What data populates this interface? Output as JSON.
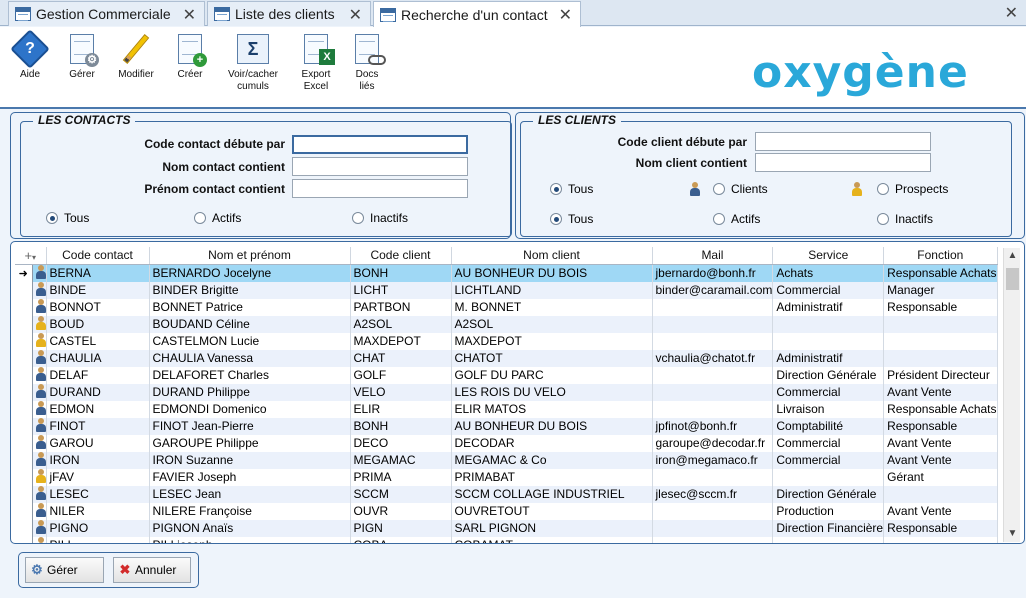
{
  "tabs": [
    {
      "label": "Gestion Commerciale",
      "active": false
    },
    {
      "label": "Liste des clients",
      "active": false
    },
    {
      "label": "Recherche d'un contact",
      "active": true
    }
  ],
  "toolbar": {
    "aide": "Aide",
    "gerer": "Gérer",
    "modifier": "Modifier",
    "creer": "Créer",
    "voir_line1": "Voir/cacher",
    "voir_line2": "cumuls",
    "export_line1": "Export",
    "export_line2": "Excel",
    "docs_line1": "Docs",
    "docs_line2": "liés"
  },
  "logo": "oxygène",
  "contacts": {
    "title": "LES CONTACTS",
    "code_label": "Code contact débute par",
    "nom_label": "Nom contact contient",
    "prenom_label": "Prénom contact contient",
    "code_value": "",
    "nom_value": "",
    "prenom_value": "",
    "radio_tous": "Tous",
    "radio_actifs": "Actifs",
    "radio_inactifs": "Inactifs",
    "selected_status": "Tous"
  },
  "clients": {
    "title": "LES CLIENTS",
    "code_label": "Code client débute par",
    "nom_label": "Nom client contient",
    "code_value": "",
    "nom_value": "",
    "type_tous": "Tous",
    "type_clients": "Clients",
    "type_prospects": "Prospects",
    "status_tous": "Tous",
    "status_actifs": "Actifs",
    "status_inactifs": "Inactifs",
    "selected_type": "Tous",
    "selected_status": "Tous"
  },
  "grid": {
    "columns": [
      "Code contact",
      "Nom et prénom",
      "Code client",
      "Nom client",
      "Mail",
      "Service",
      "Fonction"
    ],
    "rows": [
      {
        "icon": "blue",
        "code": "BERNA",
        "nom": "BERNARDO Jocelyne",
        "code_client": "BONH",
        "nom_client": "AU BONHEUR DU BOIS",
        "mail": "jbernardo@bonh.fr",
        "service": "Achats",
        "fonction": "Responsable Achats"
      },
      {
        "icon": "blue",
        "code": "BINDE",
        "nom": "BINDER Brigitte",
        "code_client": "LICHT",
        "nom_client": "LICHTLAND",
        "mail": "binder@caramail.com",
        "service": "Commercial",
        "fonction": "Manager"
      },
      {
        "icon": "blue",
        "code": "BONNOT",
        "nom": "BONNET Patrice",
        "code_client": "PARTBON",
        "nom_client": "M. BONNET",
        "mail": "",
        "service": "Administratif",
        "fonction": "Responsable"
      },
      {
        "icon": "yellow",
        "code": "BOUD",
        "nom": "BOUDAND Céline",
        "code_client": "A2SOL",
        "nom_client": "A2SOL",
        "mail": "",
        "service": "",
        "fonction": ""
      },
      {
        "icon": "yellow",
        "code": "CASTEL",
        "nom": "CASTELMON Lucie",
        "code_client": "MAXDEPOT",
        "nom_client": "MAXDEPOT",
        "mail": "",
        "service": "",
        "fonction": ""
      },
      {
        "icon": "blue",
        "code": "CHAULIA",
        "nom": "CHAULIA Vanessa",
        "code_client": "CHAT",
        "nom_client": "CHATOT",
        "mail": "vchaulia@chatot.fr",
        "service": "Administratif",
        "fonction": ""
      },
      {
        "icon": "blue",
        "code": "DELAF",
        "nom": "DELAFORET Charles",
        "code_client": "GOLF",
        "nom_client": "GOLF DU PARC",
        "mail": "",
        "service": "Direction Générale",
        "fonction": "Président Directeur"
      },
      {
        "icon": "blue",
        "code": "DURAND",
        "nom": "DURAND Philippe",
        "code_client": "VELO",
        "nom_client": "LES ROIS DU VELO",
        "mail": "",
        "service": "Commercial",
        "fonction": "Avant Vente"
      },
      {
        "icon": "blue",
        "code": "EDMON",
        "nom": "EDMONDI Domenico",
        "code_client": "ELIR",
        "nom_client": "ELIR MATOS",
        "mail": "",
        "service": "Livraison",
        "fonction": "Responsable Achats"
      },
      {
        "icon": "blue",
        "code": "FINOT",
        "nom": "FINOT Jean-Pierre",
        "code_client": "BONH",
        "nom_client": "AU BONHEUR DU BOIS",
        "mail": "jpfinot@bonh.fr",
        "service": "Comptabilité",
        "fonction": "Responsable"
      },
      {
        "icon": "blue",
        "code": "GAROU",
        "nom": "GAROUPE Philippe",
        "code_client": "DECO",
        "nom_client": "DECODAR",
        "mail": "garoupe@decodar.fr",
        "service": "Commercial",
        "fonction": "Avant Vente"
      },
      {
        "icon": "blue",
        "code": "IRON",
        "nom": "IRON Suzanne",
        "code_client": "MEGAMAC",
        "nom_client": "MEGAMAC & Co",
        "mail": "iron@megamaco.fr",
        "service": "Commercial",
        "fonction": "Avant Vente"
      },
      {
        "icon": "yellow",
        "code": "jFAV",
        "nom": "FAVIER Joseph",
        "code_client": "PRIMA",
        "nom_client": "PRIMABAT",
        "mail": "",
        "service": "",
        "fonction": "Gérant"
      },
      {
        "icon": "blue",
        "code": "LESEC",
        "nom": "LESEC Jean",
        "code_client": "SCCM",
        "nom_client": "SCCM COLLAGE INDUSTRIEL",
        "mail": "jlesec@sccm.fr",
        "service": "Direction Générale",
        "fonction": ""
      },
      {
        "icon": "blue",
        "code": "NILER",
        "nom": "NILERE Françoise",
        "code_client": "OUVR",
        "nom_client": "OUVRETOUT",
        "mail": "",
        "service": "Production",
        "fonction": "Avant Vente"
      },
      {
        "icon": "blue",
        "code": "PIGNO",
        "nom": "PIGNON Anaïs",
        "code_client": "PIGN",
        "nom_client": "SARL PIGNON",
        "mail": "",
        "service": "Direction Financière",
        "fonction": "Responsable"
      },
      {
        "icon": "yellow",
        "code": "PILI",
        "nom": "PILI joseph",
        "code_client": "COBA",
        "nom_client": "COBAMAT",
        "mail": "",
        "service": "",
        "fonction": ""
      }
    ]
  },
  "buttons": {
    "gerer": "Gérer",
    "annuler": "Annuler"
  },
  "colors": {
    "accent": "#3b6aa0",
    "selected_row": "#9fd8f5",
    "logo": "#2aa8d9"
  }
}
